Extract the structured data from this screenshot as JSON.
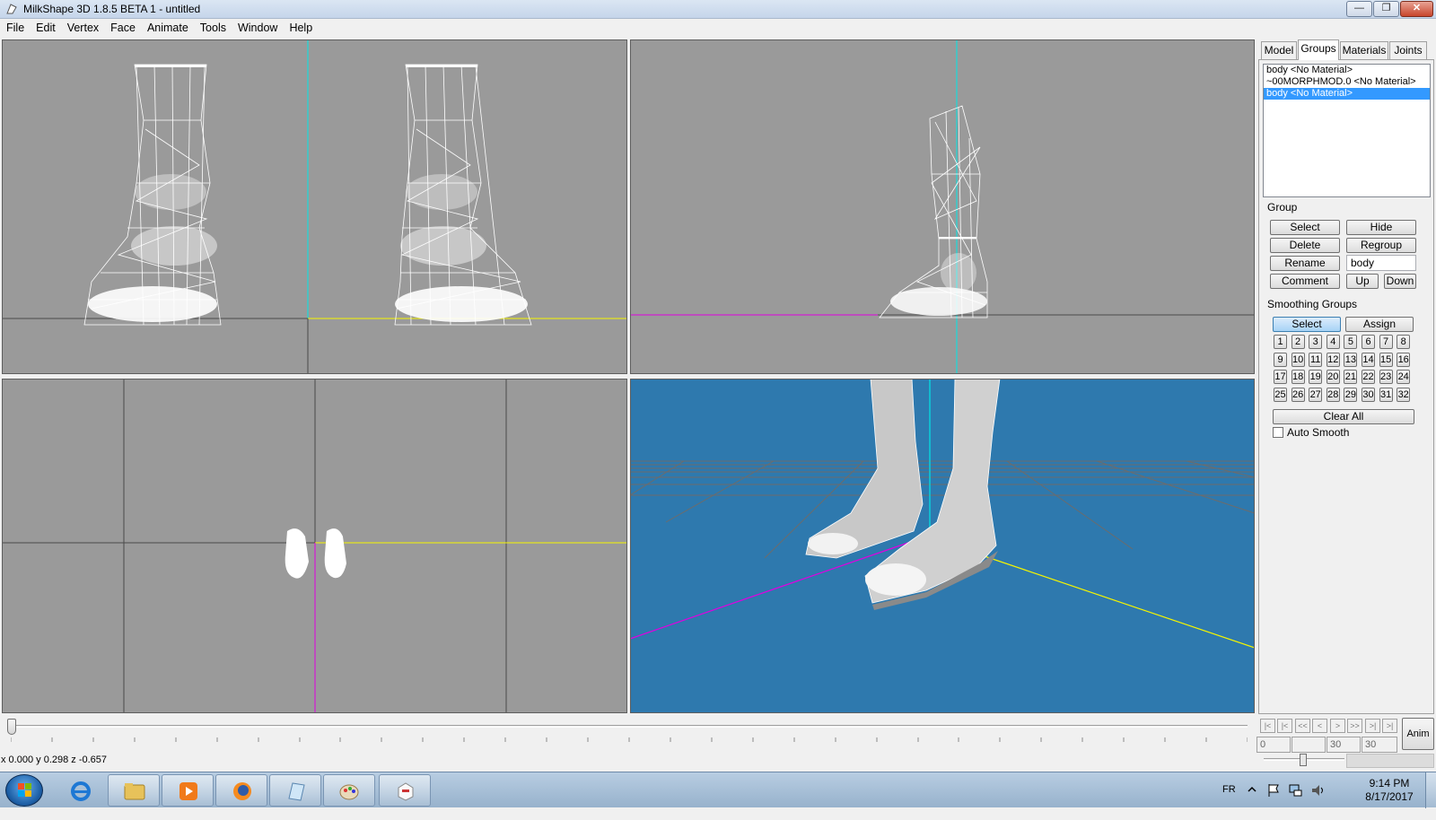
{
  "window": {
    "title": "MilkShape 3D 1.8.5 BETA 1 - untitled",
    "min_label": "—",
    "max_label": "❐",
    "close_label": "✕"
  },
  "menu": [
    "File",
    "Edit",
    "Vertex",
    "Face",
    "Animate",
    "Tools",
    "Window",
    "Help"
  ],
  "panel": {
    "tabs": [
      "Model",
      "Groups",
      "Materials",
      "Joints"
    ],
    "active_tab": "Groups",
    "groups": [
      {
        "label": "body <No Material>",
        "selected": false
      },
      {
        "label": "~00MORPHMOD.0 <No Material>",
        "selected": false
      },
      {
        "label": "body <No Material>",
        "selected": true
      }
    ],
    "group_box": {
      "title": "Group",
      "select": "Select",
      "hide": "Hide",
      "delete": "Delete",
      "regroup": "Regroup",
      "rename": "Rename",
      "name_value": "body",
      "comment": "Comment",
      "up": "Up",
      "down": "Down"
    },
    "smoothing": {
      "title": "Smoothing Groups",
      "select": "Select",
      "assign": "Assign",
      "numbers": [
        "1",
        "2",
        "3",
        "4",
        "5",
        "6",
        "7",
        "8",
        "9",
        "10",
        "11",
        "12",
        "13",
        "14",
        "15",
        "16",
        "17",
        "18",
        "19",
        "20",
        "21",
        "22",
        "23",
        "24",
        "25",
        "26",
        "27",
        "28",
        "29",
        "30",
        "31",
        "32"
      ],
      "clear_all": "Clear All",
      "auto_smooth": "Auto Smooth"
    }
  },
  "animation": {
    "buttons": [
      "|<",
      "|<",
      "<<",
      "<",
      ">",
      ">>",
      ">|",
      ">|"
    ],
    "frame_fields": [
      "0",
      "",
      "30",
      "30"
    ],
    "anim_label": "Anim"
  },
  "status": {
    "coords": "x 0.000 y 0.298 z -0.657"
  },
  "taskbar": {
    "apps": [
      "ie-icon",
      "explorer-icon",
      "media-player-icon",
      "firefox-icon",
      "notepad-icon",
      "paint-icon",
      "milkshape-icon"
    ],
    "lang": "FR",
    "time": "9:14 PM",
    "date": "8/17/2017"
  },
  "colors": {
    "viewport_bg": "#9a9a9a",
    "perspective_bg": "#2e79ae",
    "axis_x": "#f5f500",
    "axis_y": "#00e5e5",
    "axis_z": "#e000e0",
    "selection": "#3399ff"
  }
}
